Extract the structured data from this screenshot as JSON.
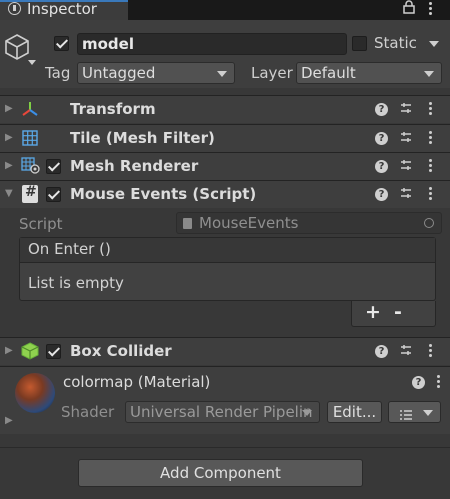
{
  "window": {
    "tab_label": "Inspector"
  },
  "object": {
    "name": "model",
    "active": true,
    "static_label": "Static",
    "tag_label": "Tag",
    "tag_value": "Untagged",
    "layer_label": "Layer",
    "layer_value": "Default"
  },
  "components": [
    {
      "title": "Transform",
      "has_checkbox": false
    },
    {
      "title": "Tile (Mesh Filter)",
      "has_checkbox": false
    },
    {
      "title": "Mesh Renderer",
      "has_checkbox": true,
      "enabled": true
    },
    {
      "title": "Mouse Events (Script)",
      "has_checkbox": true,
      "enabled": true,
      "expanded": true
    }
  ],
  "script": {
    "label": "Script",
    "value": "MouseEvents",
    "event_header": "On Enter ()",
    "empty_text": "List is empty",
    "add": "+",
    "remove": "-"
  },
  "box_collider": {
    "title": "Box Collider",
    "enabled": true
  },
  "material": {
    "title": "colormap (Material)",
    "shader_label": "Shader",
    "shader_value": "Universal Render Pipelin",
    "edit_label": "Edit..."
  },
  "add_component_label": "Add Component"
}
